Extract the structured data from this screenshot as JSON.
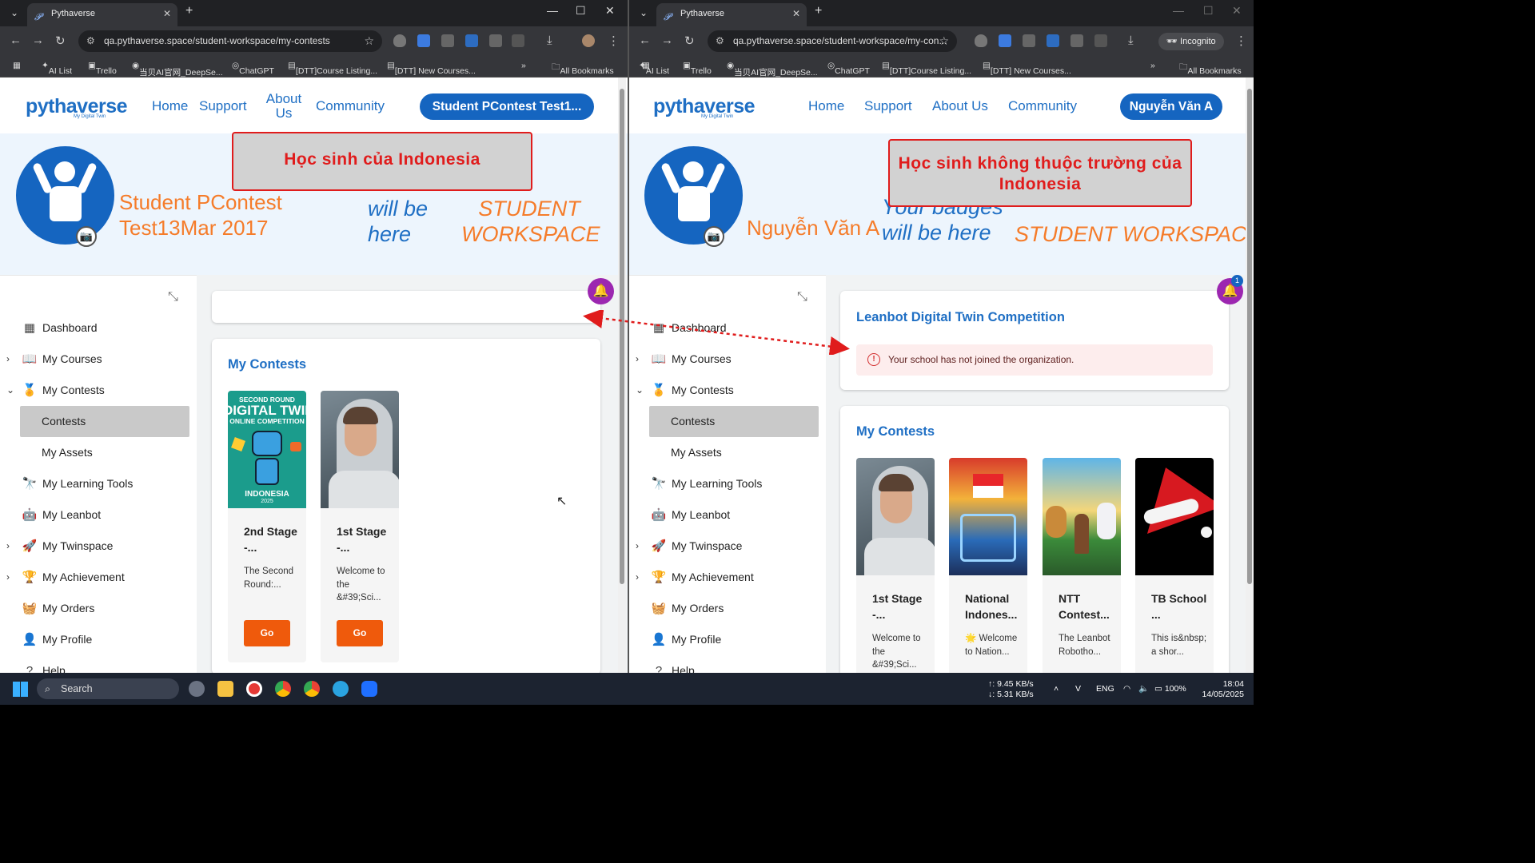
{
  "browser_left": {
    "tab_title": "Pythaverse",
    "url": "qa.pythaverse.space/student-workspace/my-contests",
    "bookmarks": [
      "AI List",
      "Trello",
      "当贝AI官网_DeepSe...",
      "ChatGPT",
      "[DTT]Course Listing...",
      "[DTT] New Courses...",
      "All Bookmarks"
    ]
  },
  "browser_right": {
    "tab_title": "Pythaverse",
    "url": "qa.pythaverse.space/student-workspace/my-con...",
    "incognito_label": "Incognito",
    "bookmarks": [
      "AI List",
      "Trello",
      "当贝AI官网_DeepSe...",
      "ChatGPT",
      "[DTT]Course Listing...",
      "[DTT] New Courses...",
      "All Bookmarks"
    ]
  },
  "site": {
    "nav": [
      "Home",
      "Support",
      "About Us",
      "Community"
    ],
    "sidebar": [
      "Dashboard",
      "My Courses",
      "My Contests",
      "Contests",
      "My Assets",
      "My Learning Tools",
      "My Leanbot",
      "My Twinspace",
      "My Achievement",
      "My Orders",
      "My Profile",
      "Help"
    ],
    "my_contests_title": "My Contests",
    "go_label": "Go",
    "badges_text": "Your badges will be here",
    "workspace_text": "STUDENT WORKSPACE"
  },
  "left_page": {
    "user_button": "Student PContest Test1...",
    "user_name": "Student PContest Test13Mar 2017",
    "badges_visible": "will be here",
    "workspace_visible": "STUDENT WORKSPACE",
    "callout": "Học sinh của Indonesia",
    "contests": [
      {
        "title": "2nd Stage -...",
        "desc": "The Second Round:...",
        "img": "digital-twin-poster",
        "img_text": [
          "SECOND ROUND",
          "DIGITAL TWIN",
          "ONLINE COMPETITION",
          "INDONESIA",
          "2025"
        ]
      },
      {
        "title": "1st Stage -...",
        "desc": "Welcome to the &#39;Sci...",
        "img": "astronaut"
      }
    ]
  },
  "right_page": {
    "user_button": "Nguyễn Văn A",
    "user_name": "Nguyễn Văn A",
    "badges_visible": "Your badges will be here",
    "workspace_visible": "STUDENT WORKSPACE",
    "callout": "Học sinh không thuộc trường của Indonesia",
    "org_card_title": "Leanbot Digital Twin Competition",
    "alert_text": "Your school has not joined the organization.",
    "notification_count": "1",
    "contests": [
      {
        "title": "1st Stage -...",
        "desc": "Welcome to the &#39;Sci...",
        "img": "astronaut"
      },
      {
        "title": "National Indones...",
        "desc": "🌟 Welcome to Nation...",
        "img": "national-arena"
      },
      {
        "title": "NTT Contest...",
        "desc": "The Leanbot Robotho...",
        "img": "fantasy-path"
      },
      {
        "title": "TB School ...",
        "desc": "This is&nbsp; a shor...",
        "img": "santa-hat"
      }
    ]
  },
  "taskbar": {
    "search": "Search",
    "net_up": "↑: 9.45 KB/s",
    "net_down": "↓: 5.31 KB/s",
    "lang": "ENG",
    "battery": "100%",
    "time": "18:04",
    "date": "14/05/2025"
  },
  "colors": {
    "brand": "#1f6fc4",
    "button": "#1565c0",
    "orange": "#f57c2a",
    "go": "#ef5a0c",
    "callout_border": "#e01c1c",
    "bell": "#9c27b0"
  }
}
